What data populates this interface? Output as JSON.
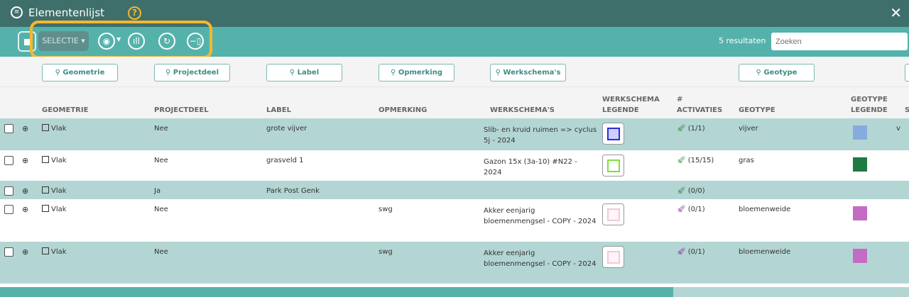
{
  "title": "Elementenlijst",
  "toolbar": {
    "selection_label": "SELECTIE ▾",
    "results": "5 resultaten",
    "search_placeholder": "Zoeken"
  },
  "filters": [
    "Geometrie",
    "Projectdeel",
    "Label",
    "Opmerking",
    "Werkschema's",
    "Geotype"
  ],
  "columns": {
    "geometrie": "GEOMETRIE",
    "projectdeel": "PROJECTDEEL",
    "label": "LABEL",
    "opmerking": "OPMERKING",
    "werkschemas": "WERKSCHEMA'S",
    "ws_legende": "WERKSCHEMA LEGENDE",
    "activaties": "# ACTIVATIES",
    "geotype": "GEOTYPE",
    "geo_legende": "GEOTYPE LEGENDE",
    "s": "S"
  },
  "rows": [
    {
      "geometrie": "Vlak",
      "projectdeel": "Nee",
      "label": "grote vijver",
      "opmerking": "",
      "werkschema": "Slib- en kruid ruimen => cyclus 5j - 2024",
      "ws_color": "#2b2bdc",
      "ws_fill": "#cfd0ff",
      "activaties": "(1/1)",
      "rocket_color": "#1f7a2e",
      "geotype": "vijver",
      "geo_color": "#86abdf",
      "s": "v"
    },
    {
      "geometrie": "Vlak",
      "projectdeel": "Nee",
      "label": "grasveld 1",
      "opmerking": "",
      "werkschema": "Gazon 15x (3a-10) #N22 - 2024",
      "ws_color": "#7ee03a",
      "ws_fill": "#ffffff",
      "activaties": "(15/15)",
      "rocket_color": "#1f7a2e",
      "geotype": "gras",
      "geo_color": "#1e7a43",
      "s": ""
    },
    {
      "geometrie": "Vlak",
      "projectdeel": "Ja",
      "label": "Park Post Genk",
      "opmerking": "",
      "werkschema": "",
      "activaties": "(0/0)",
      "rocket_color": "#1f7a2e",
      "geotype": "",
      "s": ""
    },
    {
      "geometrie": "Vlak",
      "projectdeel": "Nee",
      "label": "",
      "opmerking": "swg",
      "werkschema": "Akker eenjarig bloemenmengsel - COPY - 2024",
      "ws_color": "#f3c9d6",
      "ws_fill": "#fff4f7",
      "activaties": "(0/1)",
      "rocket_color": "#7a1a86",
      "geotype": "bloemenweide",
      "geo_color": "#c46bc6",
      "s": ""
    },
    {
      "geometrie": "Vlak",
      "projectdeel": "Nee",
      "label": "",
      "opmerking": "swg",
      "werkschema": "Akker eenjarig bloemenmengsel - COPY - 2024",
      "ws_color": "#f3c9d6",
      "ws_fill": "#fff4f7",
      "activaties": "(0/1)",
      "rocket_color": "#7a1a86",
      "geotype": "bloemenweide",
      "geo_color": "#c46bc6",
      "s": ""
    }
  ]
}
